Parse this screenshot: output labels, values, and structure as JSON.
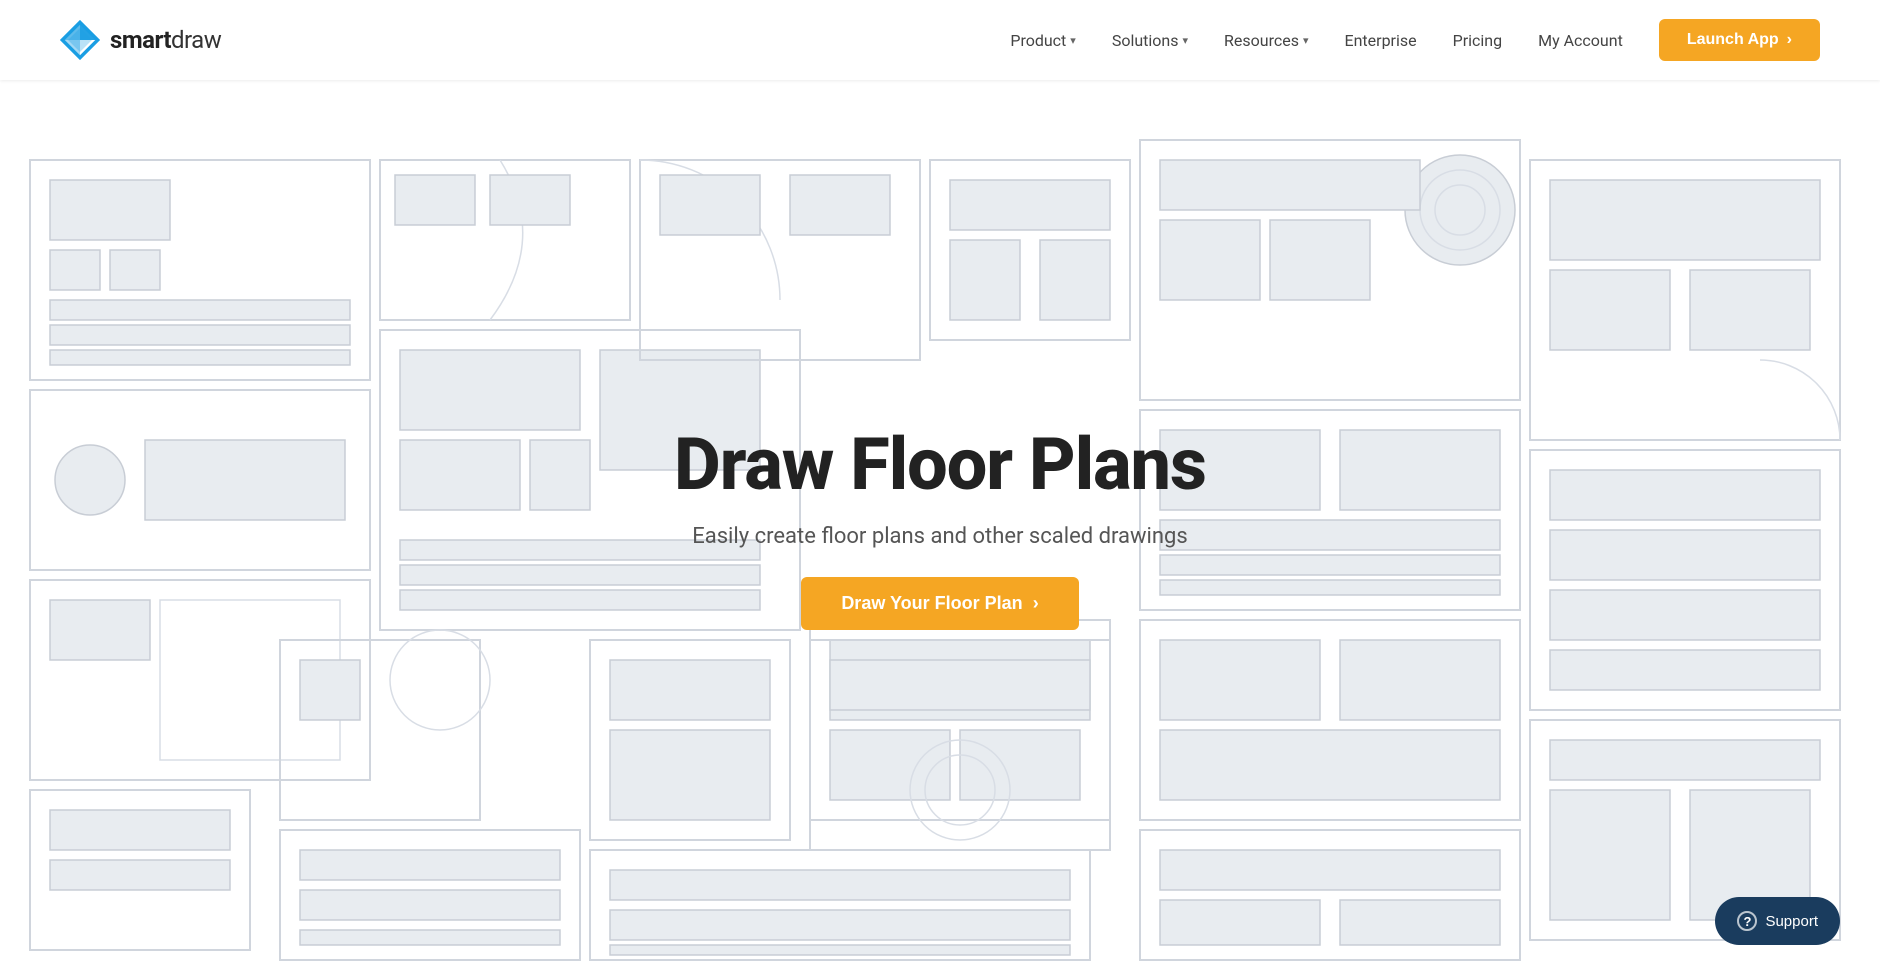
{
  "header": {
    "logo_smart": "smart",
    "logo_draw": "draw",
    "nav": {
      "product_label": "Product",
      "solutions_label": "Solutions",
      "resources_label": "Resources",
      "enterprise_label": "Enterprise",
      "pricing_label": "Pricing",
      "my_account_label": "My Account",
      "launch_label": "Launch App",
      "launch_arrow": "›"
    }
  },
  "hero": {
    "title": "Draw Floor Plans",
    "subtitle": "Easily create floor plans and other scaled drawings",
    "cta_label": "Draw Your Floor Plan",
    "cta_arrow": "›"
  },
  "support": {
    "label": "Support",
    "icon": "?"
  },
  "colors": {
    "accent": "#f5a623",
    "dark_blue": "#1a3c5e",
    "text_primary": "#222222",
    "text_secondary": "#555555"
  }
}
